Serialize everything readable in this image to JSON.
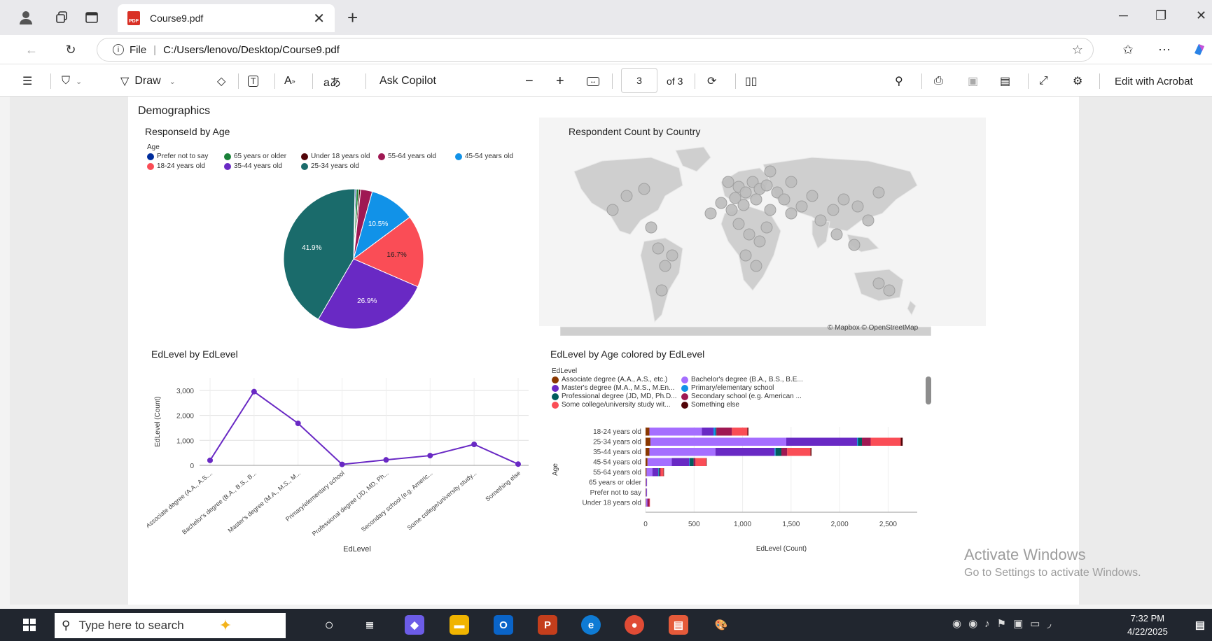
{
  "browser": {
    "tab_title": "Course9.pdf",
    "address_prefix": "File",
    "address_url": "C:/Users/lenovo/Desktop/Course9.pdf"
  },
  "pdf_toolbar": {
    "draw_label": "Draw",
    "copilot_label": "Ask Copilot",
    "page_current": "3",
    "page_total": "of 3",
    "edit_label": "Edit with Acrobat"
  },
  "document": {
    "heading": "Demographics",
    "pie": {
      "title": "ResponseId by Age",
      "legend_title": "Age"
    },
    "map": {
      "title": "Respondent Count by Country",
      "attribution": "© Mapbox © OpenStreetMap"
    },
    "line": {
      "title": "EdLevel by EdLevel",
      "xlabel": "EdLevel",
      "ylabel": "EdLevel (Count)"
    },
    "bar": {
      "title": "EdLevel by Age colored by EdLevel",
      "legend_title": "EdLevel",
      "xlabel": "EdLevel (Count)",
      "ylabel": "Age"
    }
  },
  "chart_data": [
    {
      "type": "pie",
      "title": "ResponseId by Age",
      "legend": [
        "Prefer not to say",
        "65 years or older",
        "Under 18 years old",
        "55-64 years old",
        "45-54 years old",
        "18-24 years old",
        "35-44 years old",
        "25-34 years old"
      ],
      "slices": [
        {
          "label": "Prefer not to say",
          "value": 0.3,
          "color": "#002d9c",
          "text": ""
        },
        {
          "label": "65 years or older",
          "value": 0.6,
          "color": "#198038",
          "text": ""
        },
        {
          "label": "Under 18 years old",
          "value": 0.4,
          "color": "#520408",
          "text": ""
        },
        {
          "label": "55-64 years old",
          "value": 2.7,
          "color": "#9f1853",
          "text": ""
        },
        {
          "label": "45-54 years old",
          "value": 10.5,
          "color": "#1192e8",
          "text": "10.5%"
        },
        {
          "label": "18-24 years old",
          "value": 16.7,
          "color": "#fa4d56",
          "text": "16.7%"
        },
        {
          "label": "35-44 years old",
          "value": 26.9,
          "color": "#6929c4",
          "text": "26.9%"
        },
        {
          "label": "25-34 years old",
          "value": 41.9,
          "color": "#1a6b6b",
          "text": "41.9%"
        }
      ]
    },
    {
      "type": "line",
      "title": "EdLevel by EdLevel",
      "xlabel": "EdLevel",
      "ylabel": "EdLevel (Count)",
      "categories": [
        "Associate degree (A.A., A.S....",
        "Bachelor's degree (B.A., B.S., B...",
        "Master's degree (M.A., M.S., M...",
        "Primary/elementary school",
        "Professional degree (JD, MD, Ph...",
        "Secondary school (e.g. Americ...",
        "Some college/university study...",
        "Something else"
      ],
      "values": [
        200,
        2950,
        1680,
        40,
        220,
        390,
        840,
        50
      ],
      "ylim": [
        0,
        3500
      ],
      "yticks": [
        "0",
        "1,000",
        "2,000",
        "3,000"
      ],
      "color": "#6929c4"
    },
    {
      "type": "bar",
      "orientation": "horizontal-stacked",
      "title": "EdLevel by Age colored by EdLevel",
      "xlabel": "EdLevel (Count)",
      "ylabel": "Age",
      "legend": [
        {
          "name": "Associate degree (A.A., A.S., etc.)",
          "color": "#8a3800"
        },
        {
          "name": "Bachelor's degree (B.A., B.S., B.E...",
          "color": "#a56eff"
        },
        {
          "name": "Master's degree (M.A., M.S., M.En...",
          "color": "#6929c4"
        },
        {
          "name": "Primary/elementary school",
          "color": "#1192e8"
        },
        {
          "name": "Professional degree (JD, MD, Ph.D...",
          "color": "#005d5d"
        },
        {
          "name": "Secondary school (e.g. American ...",
          "color": "#9f1853"
        },
        {
          "name": "Some college/university study wit...",
          "color": "#fa4d56"
        },
        {
          "name": "Something else",
          "color": "#520408"
        }
      ],
      "categories": [
        "18-24 years old",
        "25-34 years old",
        "35-44 years old",
        "45-54 years old",
        "55-64 years old",
        "65 years or older",
        "Prefer not to say",
        "Under 18 years old"
      ],
      "stacks": [
        [
          40,
          540,
          120,
          20,
          10,
          160,
          160,
          10
        ],
        [
          50,
          1400,
          730,
          10,
          40,
          90,
          310,
          20
        ],
        [
          40,
          680,
          610,
          10,
          60,
          60,
          240,
          10
        ],
        [
          20,
          250,
          180,
          5,
          40,
          20,
          110,
          5
        ],
        [
          10,
          60,
          60,
          5,
          10,
          10,
          30,
          5
        ],
        [
          5,
          5,
          5,
          0,
          0,
          0,
          0,
          0
        ],
        [
          5,
          5,
          5,
          0,
          0,
          0,
          0,
          0
        ],
        [
          5,
          10,
          5,
          0,
          0,
          20,
          5,
          0
        ]
      ],
      "xlim": [
        0,
        2800
      ],
      "xticks": [
        "0",
        "500",
        "1,000",
        "1,500",
        "2,000",
        "2,500"
      ]
    }
  ]
}
